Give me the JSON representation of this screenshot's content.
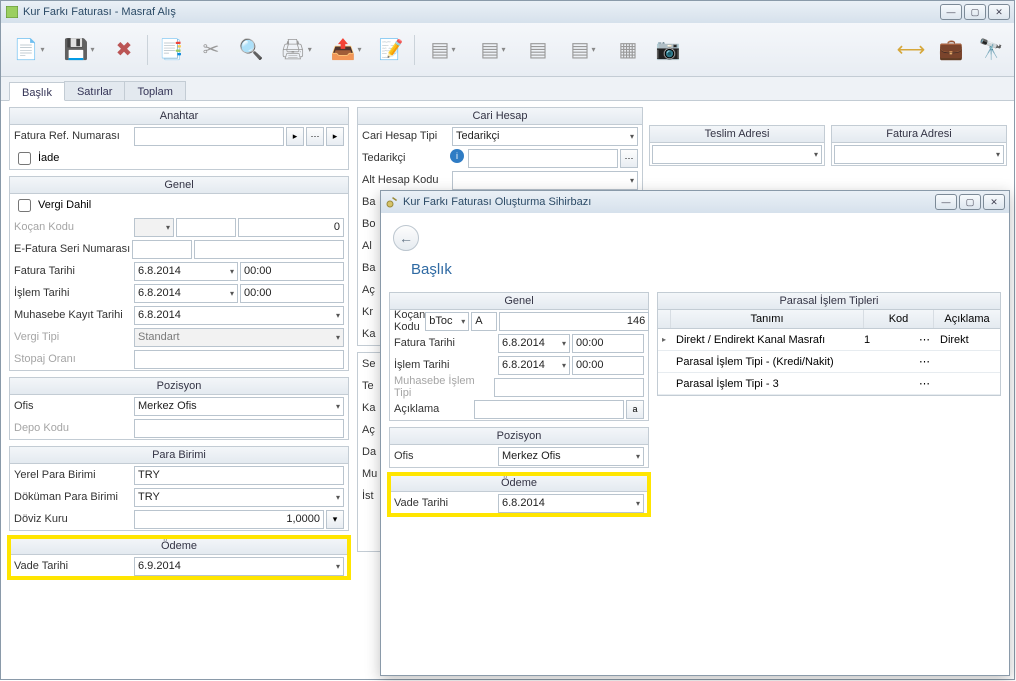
{
  "mainWindow": {
    "title": "Kur Farkı Faturası - Masraf Alış"
  },
  "tabs": {
    "t0": "Başlık",
    "t1": "Satırlar",
    "t2": "Toplam"
  },
  "anahtar": {
    "header": "Anahtar",
    "faturaRefNo": "Fatura Ref. Numarası",
    "iade": "İade"
  },
  "genel": {
    "header": "Genel",
    "vergiDahil": "Vergi Dahil",
    "kocanKodu": "Koçan Kodu",
    "kocanVal": "0",
    "efatura": "E-Fatura Seri Numarası",
    "faturaTarihi": "Fatura Tarihi",
    "faturaDate": "6.8.2014",
    "faturaTime": "00:00",
    "islemTarihi": "İşlem Tarihi",
    "islemDate": "6.8.2014",
    "islemTime": "00:00",
    "muhKayit": "Muhasebe Kayıt Tarihi",
    "muhDate": "6.8.2014",
    "vergiTipi": "Vergi Tipi",
    "vergiTipiVal": "Standart",
    "stopaj": "Stopaj Oranı"
  },
  "pozisyon": {
    "header": "Pozisyon",
    "ofis": "Ofis",
    "ofisVal": "Merkez Ofis",
    "depo": "Depo Kodu"
  },
  "para": {
    "header": "Para Birimi",
    "yerel": "Yerel Para Birimi",
    "yerelVal": "TRY",
    "dokuman": "Döküman Para Birimi",
    "dokumanVal": "TRY",
    "doviz": "Döviz Kuru",
    "dovizVal": "1,0000"
  },
  "odeme": {
    "header": "Ödeme",
    "vade": "Vade Tarihi",
    "vadeVal": "6.9.2014"
  },
  "cari": {
    "header": "Cari Hesap",
    "tip": "Cari Hesap Tipi",
    "tipVal": "Tedarikçi",
    "tedarikci": "Tedarikçi",
    "altHesap": "Alt Hesap Kodu",
    "ba": "Ba",
    "bo": "Bo",
    "al": "Al",
    "ba2": "Ba",
    "ac": "Aç",
    "kr": "Kr",
    "ka": "Ka"
  },
  "midlist": {
    "seu": "Se",
    "tes": "Te",
    "kar": "Ka",
    "ac": "Aç",
    "da": "Da",
    "mu": "Mu",
    "ist": "İst"
  },
  "rightPanels": {
    "teslim": "Teslim Adresi",
    "fatura": "Fatura Adresi"
  },
  "wizard": {
    "title": "Kur Farkı Faturası Oluşturma Sihirbazı",
    "heading": "Başlık",
    "genel": {
      "header": "Genel",
      "kocan": "Koçan Kodu",
      "kocanVal": "bToc",
      "kocanSeq1": "A",
      "kocanSeq2": "146",
      "fatTar": "Fatura Tarihi",
      "fatDate": "6.8.2014",
      "fatTime": "00:00",
      "islTar": "İşlem Tarihi",
      "islDate": "6.8.2014",
      "islTime": "00:00",
      "muhTip": "Muhasebe İşlem Tipi",
      "aciklama": "Açıklama"
    },
    "poz": {
      "header": "Pozisyon",
      "ofis": "Ofis",
      "ofisVal": "Merkez Ofis"
    },
    "ode": {
      "header": "Ödeme",
      "vade": "Vade Tarihi",
      "vadeVal": "6.8.2014"
    },
    "grid": {
      "header": "Parasal İşlem Tipleri",
      "colTanimi": "Tanımı",
      "colKod": "Kod",
      "colAciklama": "Açıklama",
      "rows": [
        {
          "tanimi": "Direkt / Endirekt Kanal Masrafı",
          "kod": "1",
          "aciklama": "Direkt"
        },
        {
          "tanimi": "Parasal İşlem Tipi - (Kredi/Nakit)",
          "kod": "",
          "aciklama": ""
        },
        {
          "tanimi": "Parasal İşlem Tipi - 3",
          "kod": "",
          "aciklama": ""
        }
      ]
    }
  }
}
